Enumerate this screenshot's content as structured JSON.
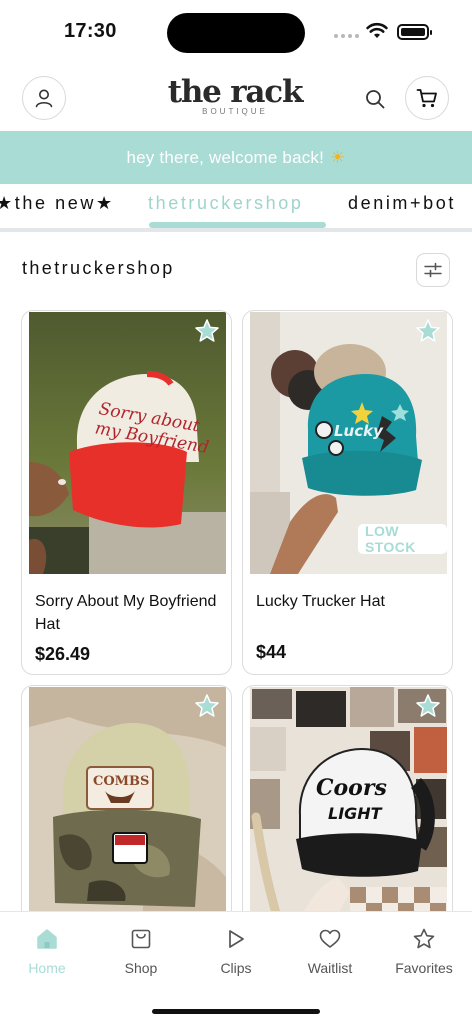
{
  "status_bar": {
    "time": "17:30"
  },
  "header": {
    "logo_main": "the rack",
    "logo_sub": "BOUTIQUE"
  },
  "banner": {
    "text": "hey there, welcome back!",
    "emoji": "☀"
  },
  "category_tabs": [
    {
      "label": "★the new★",
      "active": false
    },
    {
      "label": "thetruckershop",
      "active": true
    },
    {
      "label": "denim+bot",
      "active": false
    }
  ],
  "section": {
    "title": "thetruckershop"
  },
  "products": [
    {
      "name": "Sorry About My Boyfriend Hat",
      "price": "$26.49",
      "badge": ""
    },
    {
      "name": "Lucky Trucker Hat",
      "price": "$44",
      "badge": "LOW STOCK"
    },
    {
      "name": "",
      "price": "",
      "badge": ""
    },
    {
      "name": "",
      "price": "",
      "badge": ""
    }
  ],
  "product_image_text": {
    "hat1": [
      "Sorry about",
      "my Boyfriend"
    ],
    "hat2": "Lucky",
    "hat3": "COMBS",
    "hat4": [
      "Coors",
      "LIGHT"
    ]
  },
  "bottom_nav": [
    {
      "label": "Home",
      "icon": "home-icon",
      "active": true
    },
    {
      "label": "Shop",
      "icon": "shopping-bag-icon",
      "active": false
    },
    {
      "label": "Clips",
      "icon": "play-icon",
      "active": false
    },
    {
      "label": "Waitlist",
      "icon": "heart-icon",
      "active": false
    },
    {
      "label": "Favorites",
      "icon": "star-icon",
      "active": false
    }
  ],
  "colors": {
    "accent": "#a8dcd5",
    "text": "#111111",
    "border": "#dcdcdc"
  }
}
